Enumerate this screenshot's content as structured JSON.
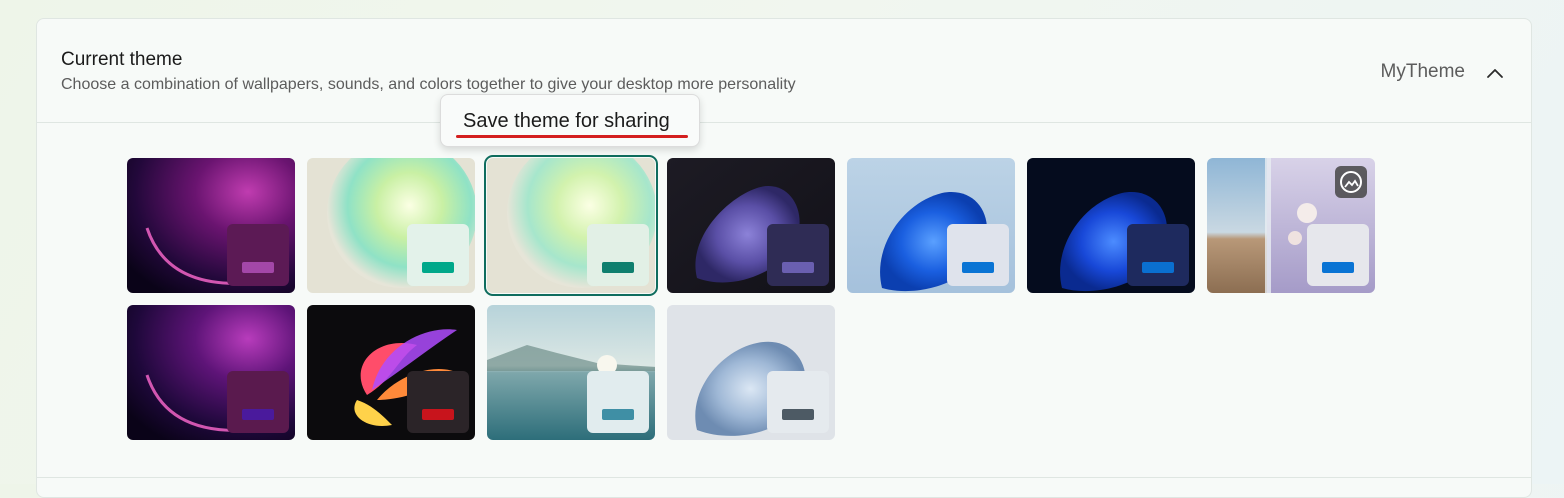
{
  "header": {
    "title": "Current theme",
    "subtitle": "Choose a combination of wallpapers, sounds, and colors together to give your desktop more personality",
    "current_theme_name": "MyTheme",
    "collapse_icon": "chevron-up-icon"
  },
  "tooltip": {
    "label": "Save theme for sharing",
    "underline_color": "#d41f1f"
  },
  "themes": [
    {
      "id": "glow-purple",
      "accent": "#a347a8",
      "badge_bg": "#5c1a55",
      "selected": false
    },
    {
      "id": "bloom-light-1",
      "accent": "#00a88a",
      "badge_bg": "#e3f2ea",
      "selected": false
    },
    {
      "id": "bloom-light-2",
      "accent": "#0f7f6e",
      "badge_bg": "#e2f0e6",
      "selected": true
    },
    {
      "id": "flow-dark",
      "accent": "#6a5fb0",
      "badge_bg": "#2f2c55",
      "selected": false
    },
    {
      "id": "bloom-blue-light",
      "accent": "#0a74d4",
      "badge_bg": "#dfe3ec",
      "selected": false
    },
    {
      "id": "bloom-blue-dark",
      "accent": "#0a6fd0",
      "badge_bg": "#1e2a5e",
      "selected": false
    },
    {
      "id": "spotlight-collection",
      "accent": "#0a74d4",
      "badge_bg": "#e6e7ec",
      "selected": false,
      "slideshow_icon": "slideshow-icon"
    },
    {
      "id": "glow-indigo",
      "accent": "#4a1a9c",
      "badge_bg": "#5a1a4e",
      "selected": false
    },
    {
      "id": "captured-motion",
      "accent": "#c8141c",
      "badge_bg": "#2b2428",
      "selected": false
    },
    {
      "id": "sunrise-lake",
      "accent": "#3f8fa5",
      "badge_bg": "#e1ecee",
      "selected": false
    },
    {
      "id": "flow-light",
      "accent": "#4d5a64",
      "badge_bg": "#e5eaee",
      "selected": false
    }
  ]
}
